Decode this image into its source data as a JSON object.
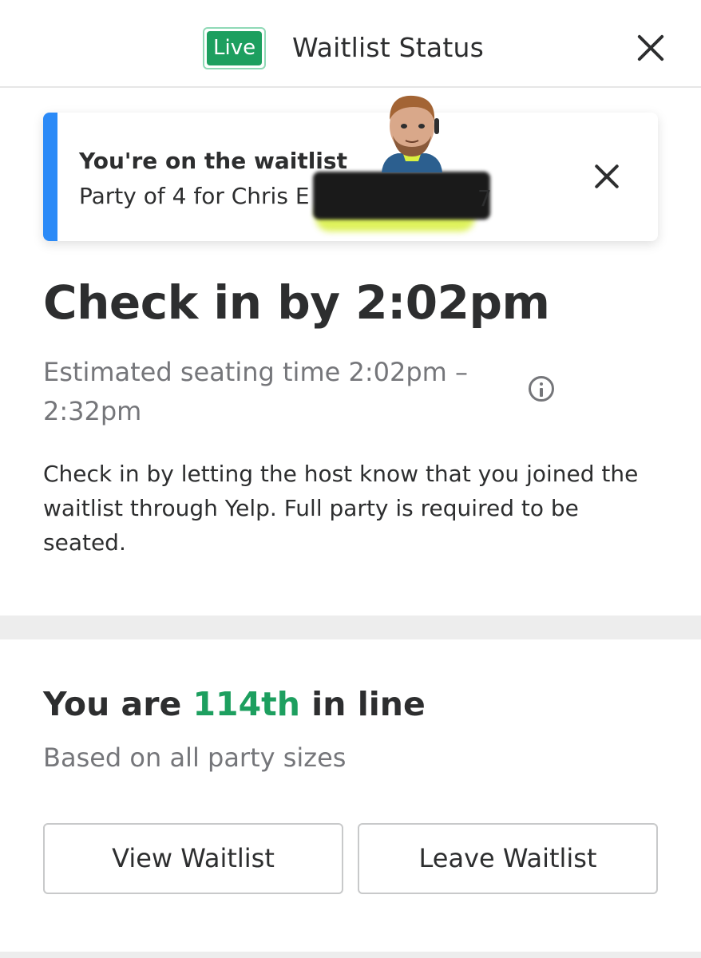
{
  "header": {
    "badge": "Live",
    "title": "Waitlist Status",
    "close_icon": "close-icon"
  },
  "toast": {
    "title": "You're on the waitlist",
    "subtitle": "Party of 4 for Chris E",
    "subtitle_tail": "7",
    "accent_color": "#2b8af7",
    "close_icon": "close-icon"
  },
  "checkin": {
    "title": "Check in by 2:02pm",
    "seating": "Estimated seating time 2:02pm – 2:32pm",
    "info_icon": "info-icon",
    "instructions": "Check in by letting the host know that you joined the waitlist through Yelp. Full party is required to be seated."
  },
  "position": {
    "prefix": "You are ",
    "place": "114th",
    "suffix": " in line",
    "subtitle": "Based on all party sizes",
    "highlight_color": "#1d9f5f"
  },
  "actions": {
    "view": "View Waitlist",
    "leave": "Leave Waitlist"
  }
}
